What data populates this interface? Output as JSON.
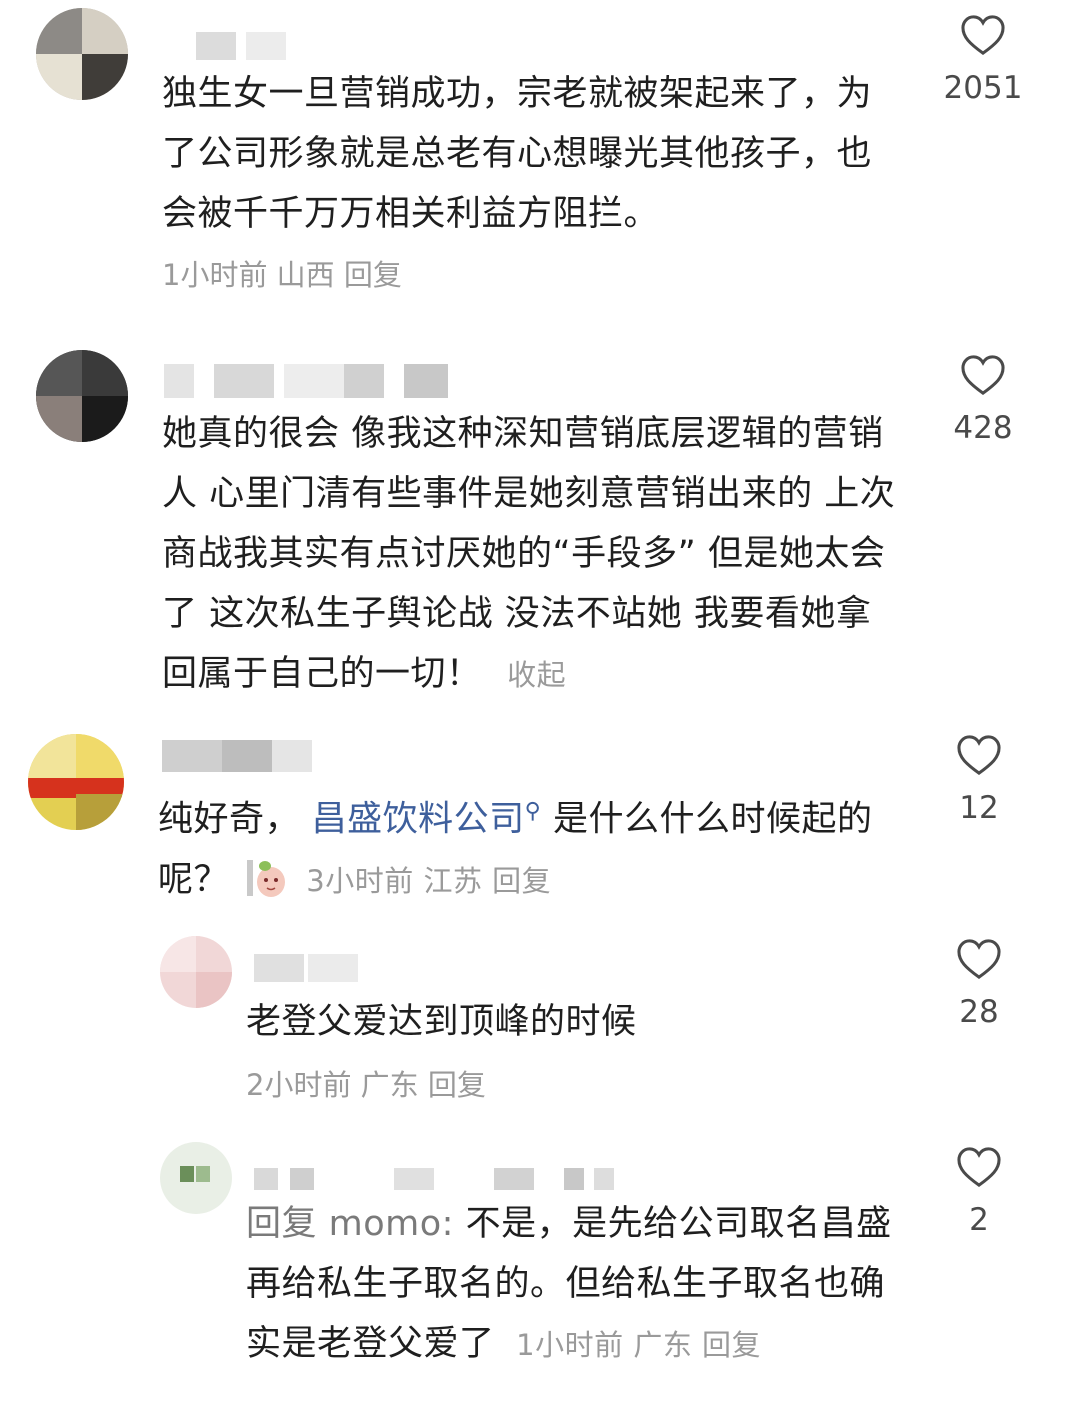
{
  "comments": [
    {
      "text": "独生女一旦营销成功，宗老就被架起来了，为了公司形象就是总老有心想曝光其他孩子，也会被千千万万相关利益方阻拦。",
      "meta": "1小时前 山西 回复",
      "likes": "2051"
    },
    {
      "text": "她真的很会 像我这种深知营销底层逻辑的营销人 心里门清有些事件是她刻意营销出来的 上次商战我其实有点讨厌她的“手段多” 但是她太会了 这次私生子舆论战 没法不站她 我要看她拿回属于自己的一切！",
      "collapse": "收起",
      "likes": "428"
    },
    {
      "text_before": "纯好奇，",
      "link": "昌盛饮料公司",
      "text_after": "是什么什么时候起的呢？",
      "meta": "3小时前 江苏 回复",
      "likes": "12"
    },
    {
      "text": "老登父爱达到顶峰的时候",
      "meta": "2小时前 广东 回复",
      "likes": "28"
    },
    {
      "prefix": "回复 momo: ",
      "text": "不是，是先给公司取名昌盛再给私生子取名的。但给私生子取名也确实是老登父爱了",
      "meta": "1小时前 广东 回复",
      "likes": "2"
    }
  ],
  "icons": {
    "like": "heart-outline-icon",
    "search": "search-icon",
    "sticker": "sticker-emoji-icon"
  },
  "colors": {
    "text": "#1f1f1f",
    "meta": "#9a9a9a",
    "link": "#3e5f9c"
  }
}
